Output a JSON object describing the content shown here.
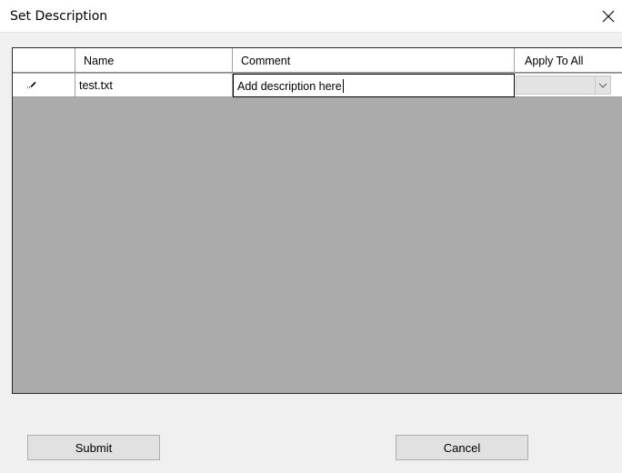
{
  "window": {
    "title": "Set Description",
    "close_glyph": "✕"
  },
  "grid": {
    "columns": [
      "",
      "Name",
      "Comment",
      "Apply To All"
    ],
    "rows": [
      {
        "indicator_icon": "pencil-icon",
        "name": "test.txt",
        "comment": "Add description here",
        "apply_to_all": ""
      }
    ]
  },
  "buttons": {
    "submit_label": "Submit",
    "cancel_label": "Cancel"
  },
  "colors": {
    "grid_background": "#ababab",
    "window_background": "#f0f0f0"
  }
}
